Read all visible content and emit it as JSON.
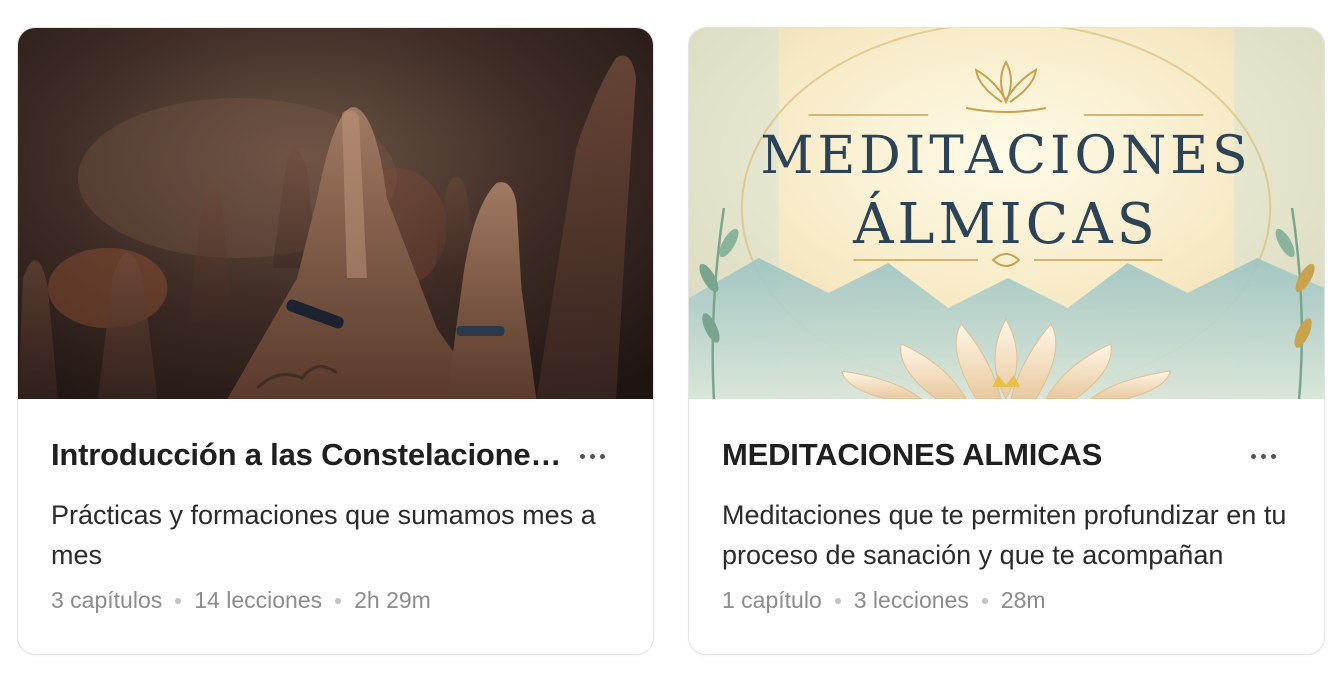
{
  "courses": [
    {
      "title": "Introducción a las Constelaciones Familiares",
      "description": "Prácticas y formaciones que sumamos mes a mes",
      "meta": {
        "chapters": "3 capítulos",
        "lessons": "14 lecciones",
        "duration": "2h 29m"
      },
      "thumbnail_icon": "praying-hands-photo"
    },
    {
      "title": "MEDITACIONES ALMICAS",
      "description": "Meditaciones que te permiten profundizar en tu proceso de sanación y que te acompañan",
      "meta": {
        "chapters": "1 capítulo",
        "lessons": "3 lecciones",
        "duration": "28m"
      },
      "thumbnail_icon": "lotus-illustration",
      "thumbnail_text": {
        "line1": "MEDITACIONES",
        "line2": "ÁLMICAS"
      }
    }
  ],
  "colors": {
    "card_border": "#e4e4e4",
    "title": "#1f1f1f",
    "meta": "#8c8c8c",
    "thumb_text": "#2c4356"
  }
}
